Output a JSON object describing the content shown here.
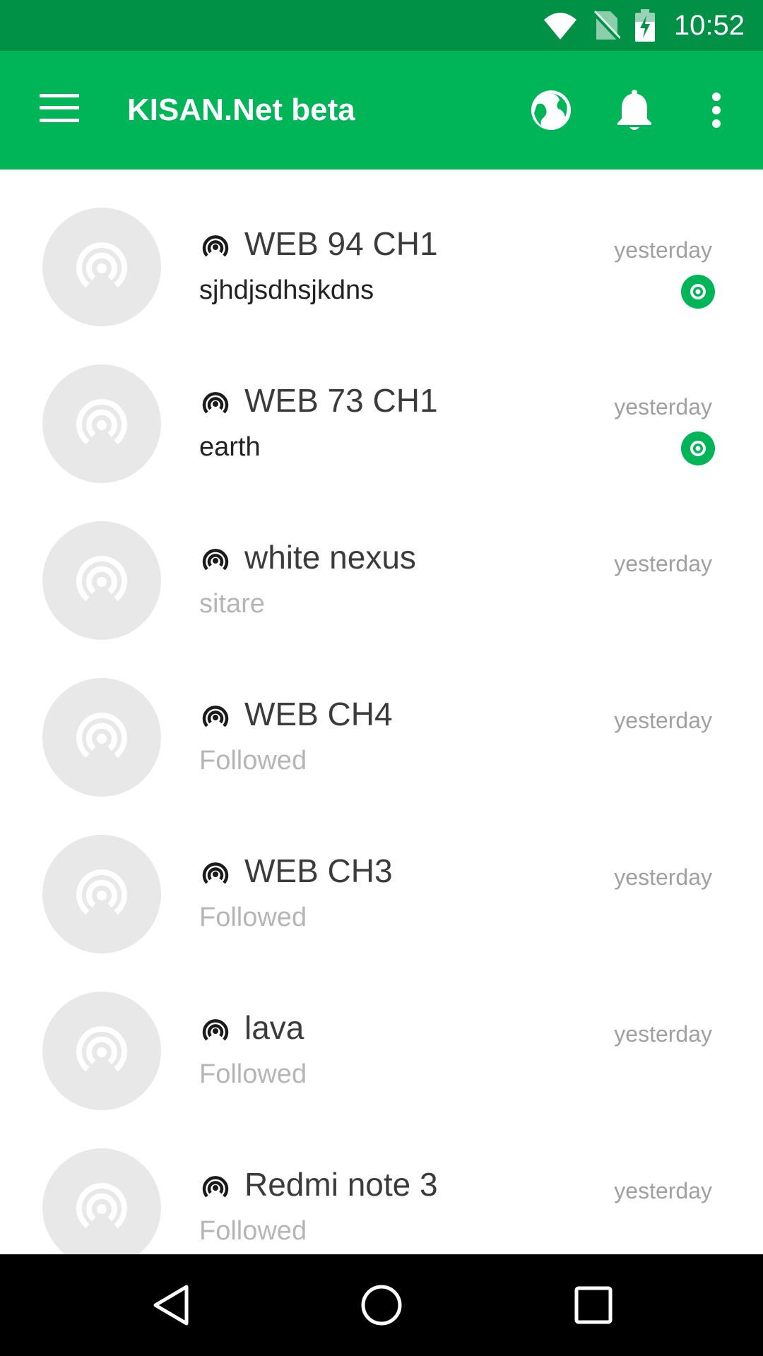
{
  "status_bar": {
    "time": "10:52",
    "icons": [
      "wifi-icon",
      "no-sim-icon",
      "battery-charging-icon"
    ]
  },
  "app_bar": {
    "title": "KISAN.Net beta",
    "actions": [
      "menu-icon",
      "globe-icon",
      "bell-icon",
      "more-vert-icon"
    ]
  },
  "channels": [
    {
      "title": "WEB 94 CH1",
      "subtitle": "sjhdjsdhsjkdns",
      "time": "yesterday",
      "unread": true,
      "subtitle_style": "dark"
    },
    {
      "title": "WEB 73 CH1",
      "subtitle": "earth",
      "time": "yesterday",
      "unread": true,
      "subtitle_style": "dark"
    },
    {
      "title": "white nexus",
      "subtitle": "sitare",
      "time": "yesterday",
      "unread": false,
      "subtitle_style": "light"
    },
    {
      "title": "WEB CH4",
      "subtitle": "Followed",
      "time": "yesterday",
      "unread": false,
      "subtitle_style": "light"
    },
    {
      "title": "WEB CH3",
      "subtitle": "Followed",
      "time": "yesterday",
      "unread": false,
      "subtitle_style": "light"
    },
    {
      "title": "lava",
      "subtitle": "Followed",
      "time": "yesterday",
      "unread": false,
      "subtitle_style": "light"
    },
    {
      "title": "Redmi note 3",
      "subtitle": "Followed",
      "time": "yesterday",
      "unread": false,
      "subtitle_style": "light"
    }
  ],
  "nav_bar": {
    "buttons": [
      "back-icon",
      "home-icon",
      "recents-icon"
    ]
  },
  "colors": {
    "status_bar": "#009147",
    "app_bar": "#00b558",
    "accent": "#00b558",
    "avatar_bg": "#e8e8e8"
  }
}
